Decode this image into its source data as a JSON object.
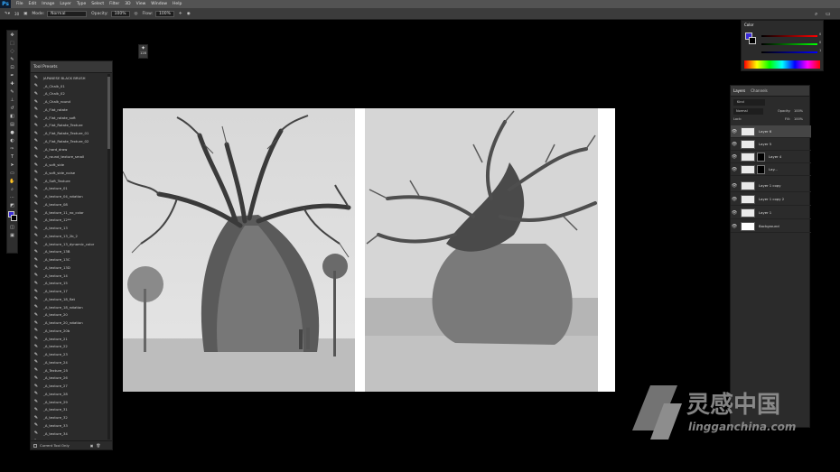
{
  "app": {
    "logo": "Ps",
    "menu": [
      "File",
      "Edit",
      "Image",
      "Layer",
      "Type",
      "Select",
      "Filter",
      "3D",
      "View",
      "Window",
      "Help"
    ]
  },
  "options": {
    "mode_label": "Mode:",
    "mode_value": "Normal",
    "opacity_label": "Opacity:",
    "opacity_value": "100%",
    "flow_label": "Flow:",
    "flow_value": "100%",
    "size_value": "30"
  },
  "floating_size": "128",
  "tool_presets": {
    "title": "Tool Presets",
    "items": [
      "JAPANESE BLACK BRUSH",
      "_A_Chalk_01",
      "_A_Chalk_02",
      "_A_Chalk_round",
      "_A_Flat_rotate",
      "_A_Flat_rotate_soft",
      "_A_Flat_Rotate_Texture",
      "_A_Flat_Rotate_Texture_01",
      "_A_Flat_Rotate_Texture_02",
      "_A_hard_draw",
      "_A_round_texture_small",
      "_A_soft_side",
      "_A_soft_side_noise",
      "_A_Soft_Texture",
      "_A_texture_01",
      "_A_texture_04_rotation",
      "_A_texture_08",
      "_A_texture_11_no_color",
      "_A_texture_12**",
      "_A_texture_13",
      "_A_texture_13_2b_2",
      "_A_texture_13_dynamic_color",
      "_A_texture_13B",
      "_A_texture_13C",
      "_A_texture_13D",
      "_A_texture_14",
      "_A_texture_15",
      "_A_texture_17",
      "_A_texture_18_flat",
      "_A_texture_18_rotation",
      "_A_texture_20",
      "_A_texture_20_rotation",
      "_A_texture_20b",
      "_A_texture_21",
      "_A_texture_22",
      "_A_texture_23",
      "_A_texture_24",
      "_A_Texture_25",
      "_A_texture_26",
      "_A_texture_27",
      "_A_texture_28",
      "_A_texture_29",
      "_A_texture_31",
      "_A_texture_32",
      "_A_texture_33",
      "_A_texture_34",
      "_Art_stamp_2"
    ],
    "footer": "Current Tool Only"
  },
  "color_panel": {
    "title": "Color",
    "values": [
      "0",
      "0",
      "1"
    ]
  },
  "layers_panel": {
    "tabs": [
      "Layers",
      "Channels"
    ],
    "kind": "Kind",
    "blend": "Normal",
    "opacity_label": "Opacity:",
    "opacity_value": "100%",
    "lock_label": "Lock:",
    "fill_label": "Fill:",
    "fill_value": "100%",
    "layers": [
      "Layer 6",
      "Layer 5",
      "Layer 4",
      "Lay...",
      "Layer 1 copy",
      "Layer 1 copy 2",
      "Layer 1",
      "Background"
    ]
  },
  "watermark": {
    "cn": "灵感中国",
    "url": "lingganchina.com"
  }
}
